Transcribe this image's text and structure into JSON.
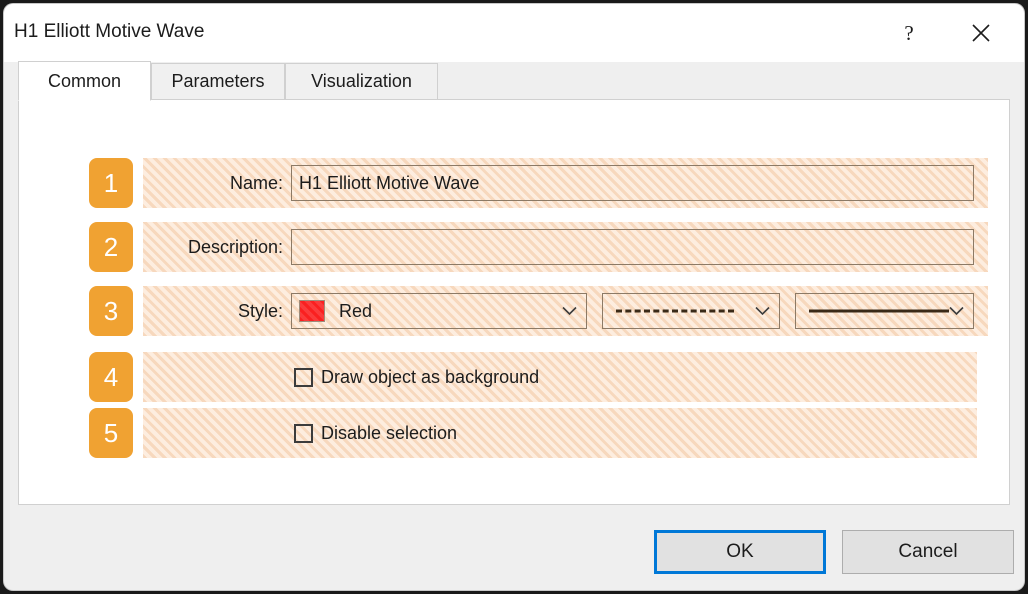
{
  "window": {
    "title": "H1 Elliott Motive Wave",
    "help_label": "?",
    "close_icon": "close-icon"
  },
  "tabs": [
    {
      "label": "Common",
      "active": true
    },
    {
      "label": "Parameters",
      "active": false
    },
    {
      "label": "Visualization",
      "active": false
    }
  ],
  "form": {
    "rows": [
      {
        "badge": "1",
        "label": "Name:",
        "type": "text",
        "value": "H1 Elliott Motive Wave",
        "placeholder": ""
      },
      {
        "badge": "2",
        "label": "Description:",
        "type": "text",
        "value": "",
        "placeholder": ""
      },
      {
        "badge": "3",
        "label": "Style:",
        "type": "style",
        "color_name": "Red",
        "color_hex": "#fa2020",
        "dash_style": "dashed",
        "width_style": "solid"
      },
      {
        "badge": "4",
        "label": "",
        "type": "checkbox",
        "checkbox_label": "Draw object as background",
        "checked": false
      },
      {
        "badge": "5",
        "label": "",
        "type": "checkbox",
        "checkbox_label": "Disable selection",
        "checked": false
      }
    ]
  },
  "footer": {
    "ok_label": "OK",
    "cancel_label": "Cancel"
  },
  "colors": {
    "badge_orange": "#f0a232",
    "focus_blue": "#0078d7",
    "hatch_base": "#fbe3cd",
    "hatch_stripe": "#f7d8bd",
    "swatch_red": "#fa2020"
  }
}
